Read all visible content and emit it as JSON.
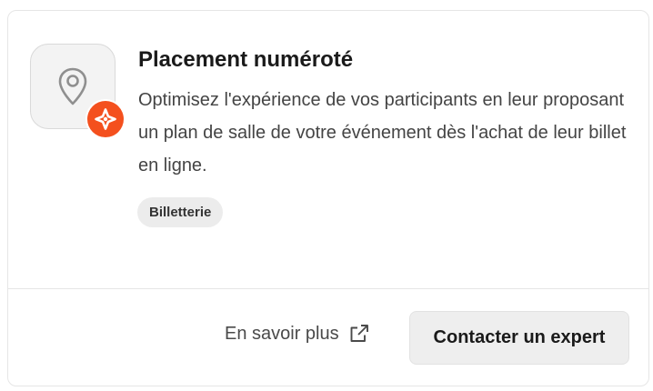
{
  "card": {
    "title": "Placement numéroté",
    "description": "Optimisez l'expérience de vos participants en leur proposant un plan de salle de votre événement dès l'achat de leur billet en ligne.",
    "tag": "Billetterie",
    "icon": "map-pin-icon",
    "badge_icon": "brand-star-icon",
    "badge_color": "#f4501e"
  },
  "actions": {
    "learn_more_label": "En savoir plus",
    "learn_more_icon": "external-link-icon",
    "contact_label": "Contacter un expert"
  }
}
